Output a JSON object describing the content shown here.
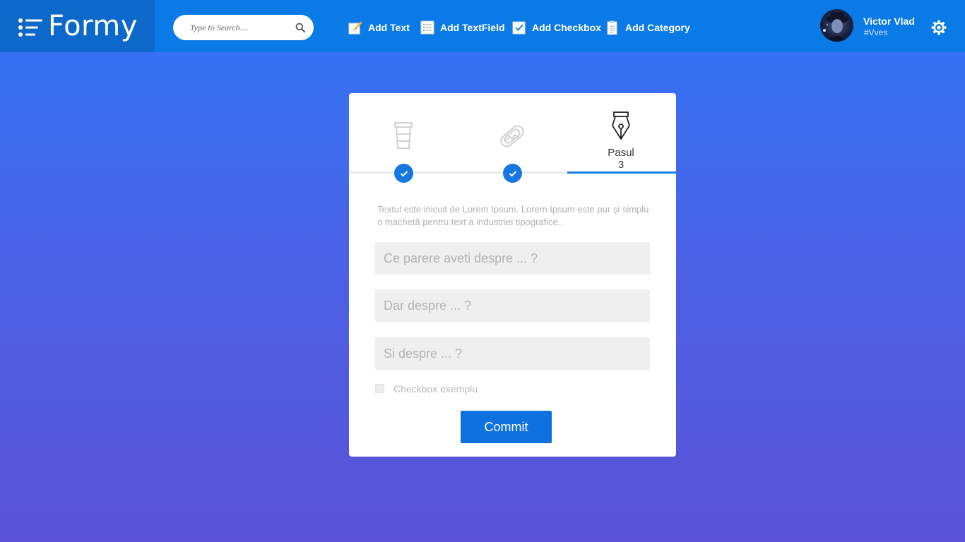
{
  "app": {
    "brand_name": "Formy"
  },
  "header": {
    "search_placeholder": "Type to Search....",
    "nav": [
      {
        "label": "Add Text",
        "icon": "pencil-note-icon"
      },
      {
        "label": "Add TextField",
        "icon": "list-icon"
      },
      {
        "label": "Add Checkbox",
        "icon": "checkbox-icon"
      },
      {
        "label": "Add Category",
        "icon": "clipboard-icon"
      }
    ],
    "user": {
      "name": "Victor Vlad",
      "handle": "#Vves"
    }
  },
  "colors": {
    "topbar": "#0a7ae6",
    "brand_bg": "#0c68c9",
    "accent": "#1677e0",
    "background_top": "#3076f7",
    "background_bottom": "#5a51d6"
  },
  "form": {
    "steps": [
      {
        "icon": "coffee-cup-icon",
        "completed": true
      },
      {
        "icon": "hotdog-icon",
        "completed": true
      },
      {
        "icon": "pen-nib-icon",
        "label": "Pasul 3",
        "active": true
      }
    ],
    "description": "Textul este inicuit de Lorem Ipsum. Lorem Ipsum este pur şi simplu o machetă pentru text a industriei tipografice..",
    "fields": [
      {
        "placeholder": "Ce parere aveti despre ... ?",
        "value": ""
      },
      {
        "placeholder": "Dar despre ... ?",
        "value": ""
      },
      {
        "placeholder": "Si despre ... ?",
        "value": ""
      }
    ],
    "checkbox": {
      "label": "Checkbox exemplu",
      "checked": false
    },
    "submit_label": "Commit"
  }
}
